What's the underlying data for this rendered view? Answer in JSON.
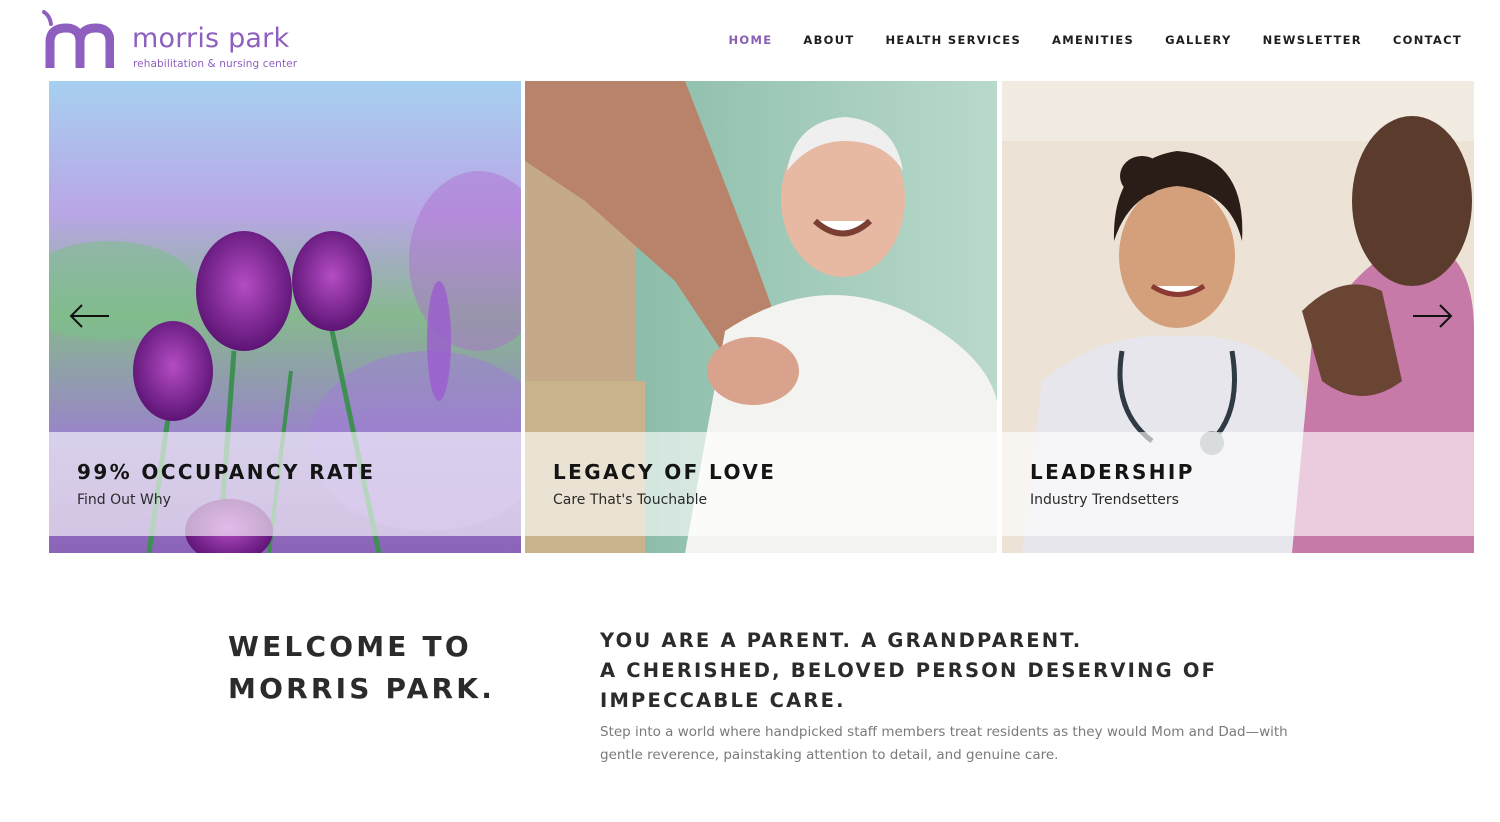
{
  "brand": {
    "name": "morris park",
    "tagline": "rehabilitation & nursing center",
    "color": "#8e5fbf"
  },
  "nav": {
    "items": [
      {
        "label": "HOME",
        "active": true
      },
      {
        "label": "ABOUT",
        "active": false
      },
      {
        "label": "HEALTH SERVICES",
        "active": false
      },
      {
        "label": "AMENITIES",
        "active": false
      },
      {
        "label": "GALLERY",
        "active": false
      },
      {
        "label": "NEWSLETTER",
        "active": false
      },
      {
        "label": "CONTACT",
        "active": false
      }
    ],
    "active_color": "#8a5fb3"
  },
  "slider": {
    "prev_icon": "arrow-left-icon",
    "next_icon": "arrow-right-icon",
    "slides": [
      {
        "title": "99% OCCUPANCY RATE",
        "subtitle": "Find Out Why",
        "image": "purple-allium-flowers"
      },
      {
        "title": "LEGACY OF LOVE",
        "subtitle": "Care That's Touchable",
        "image": "smiling-elderly-man-handshake"
      },
      {
        "title": "LEADERSHIP",
        "subtitle": "Industry Trendsetters",
        "image": "smiling-doctor-with-patient"
      }
    ]
  },
  "welcome": {
    "title_line1": "WELCOME TO",
    "title_line2": "MORRIS PARK.",
    "tagline_line1": "YOU ARE A PARENT. A GRANDPARENT.",
    "tagline_line2": "A CHERISHED, BELOVED PERSON DESERVING OF",
    "tagline_line3": "IMPECCABLE CARE.",
    "body": "Step into a world where handpicked staff members treat residents as they would Mom and Dad—with gentle reverence, painstaking attention to detail, and genuine care."
  }
}
